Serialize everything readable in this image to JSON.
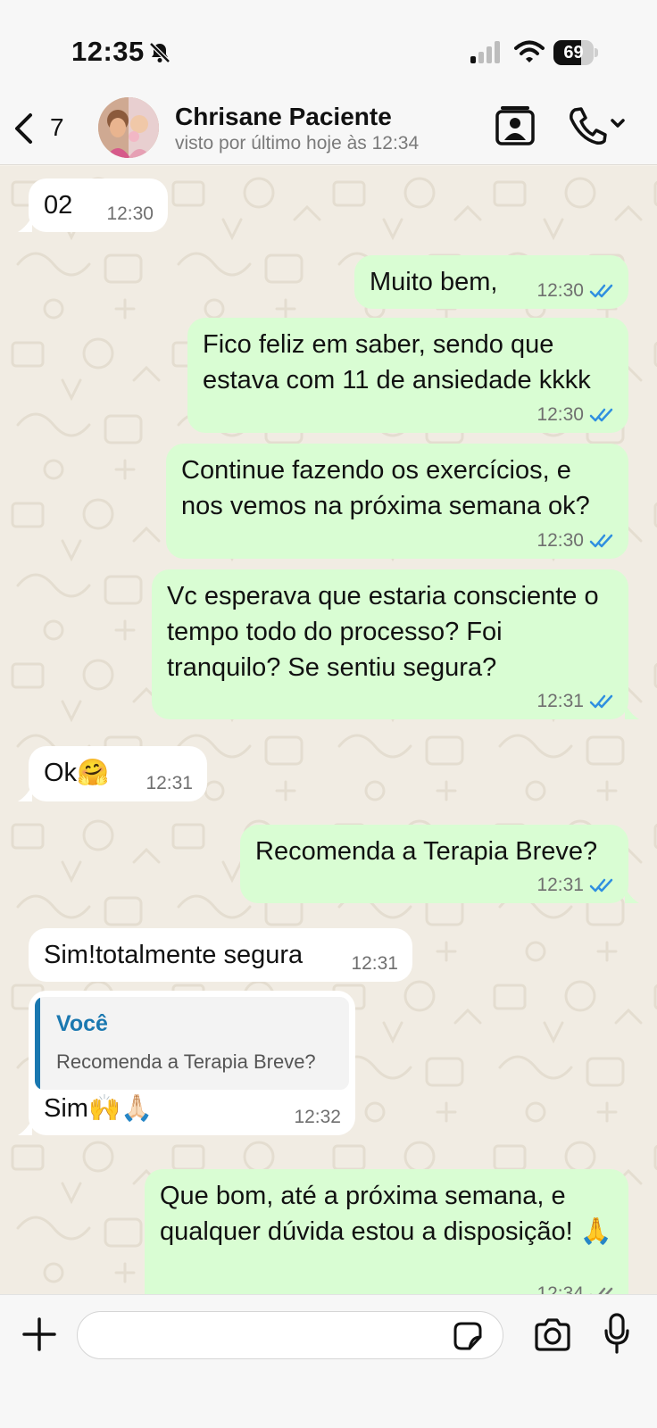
{
  "status_bar": {
    "time": "12:35",
    "battery": "69",
    "battery_level": 0.69,
    "bell_icon": "bell-slash-icon"
  },
  "header": {
    "back_count": "7",
    "contact_name": "Chrisane Paciente",
    "last_seen": "visto por último hoje às 12:34"
  },
  "messages": [
    {
      "dir": "in",
      "text": "02",
      "time": "12:30"
    },
    {
      "dir": "out",
      "text": "Muito bem,",
      "time": "12:30",
      "status": "read"
    },
    {
      "dir": "out",
      "text": "Fico feliz em saber, sendo que estava com 11 de ansiedade kkkk",
      "time": "12:30",
      "status": "read"
    },
    {
      "dir": "out",
      "text": "Continue fazendo os exercícios, e nos vemos na próxima semana ok?",
      "time": "12:30",
      "status": "read"
    },
    {
      "dir": "out",
      "text": "Vc esperava que estaria consciente o tempo todo do processo? Foi tranquilo? Se sentiu segura?",
      "time": "12:31",
      "status": "read"
    },
    {
      "dir": "in",
      "text": "Ok🤗",
      "time": "12:31"
    },
    {
      "dir": "out",
      "text": "Recomenda a Terapia Breve?",
      "time": "12:31",
      "status": "read"
    },
    {
      "dir": "in",
      "text": "Sim!totalmente segura",
      "time": "12:31"
    },
    {
      "dir": "in",
      "quote_author": "Você",
      "quote_text": "Recomenda a Terapia Breve?",
      "text": "Sim🙌🙏🏻",
      "time": "12:32"
    },
    {
      "dir": "out",
      "text": "Que bom, até a próxima semana, e qualquer dúvida estou a disposição! 🙏",
      "time": "12:34",
      "status": "delivered"
    }
  ],
  "colors": {
    "incoming_bubble": "#ffffff",
    "outgoing_bubble": "#d9fdd3",
    "read_ticks": "#2f8fe0",
    "delivered_ticks": "#7b7b7b",
    "quote_accent": "#1a78b0"
  },
  "input": {
    "placeholder": ""
  }
}
